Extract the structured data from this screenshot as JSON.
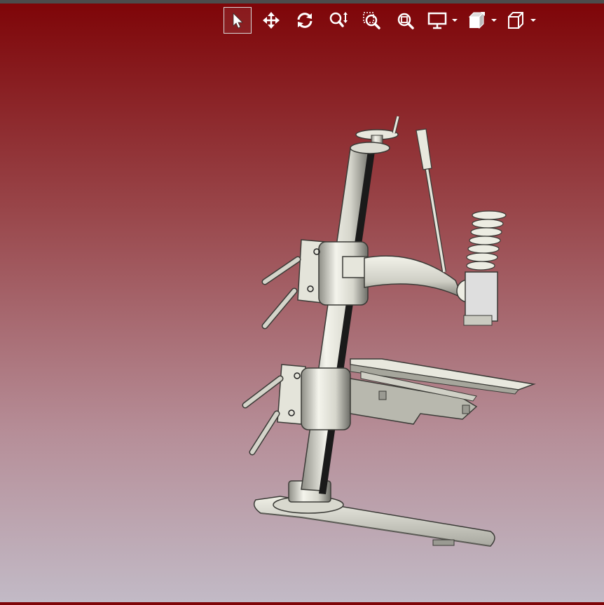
{
  "toolbar": {
    "tools": [
      {
        "id": "select",
        "icon": "pointer-arrow-icon",
        "active": true
      },
      {
        "id": "pan",
        "icon": "move-arrows-icon"
      },
      {
        "id": "rotate",
        "icon": "rotate-icon"
      },
      {
        "id": "zoom",
        "icon": "zoom-updown-icon"
      },
      {
        "id": "zoom-window",
        "icon": "zoom-window-icon"
      },
      {
        "id": "zoom-fit",
        "icon": "zoom-fit-icon"
      },
      {
        "id": "display",
        "icon": "monitor-icon",
        "dropdown": true
      },
      {
        "id": "view-style",
        "icon": "view-cube-shaded-icon",
        "dropdown": true
      },
      {
        "id": "standard-views",
        "icon": "wireframe-cube-icon",
        "dropdown": true
      }
    ]
  },
  "colors": {
    "background_top": "#7e0407",
    "background_bottom": "#c2bac6",
    "model_metal": "#e6e6dc",
    "model_shadow": "#8a8a82",
    "icon_color": "#ffffff"
  },
  "model": {
    "description_hidden": ""
  }
}
